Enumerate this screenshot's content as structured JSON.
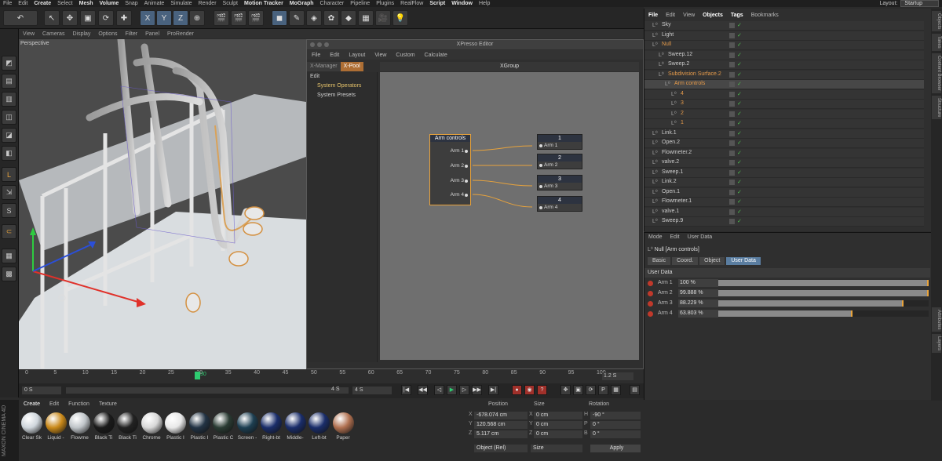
{
  "menubar": {
    "items": [
      "File",
      "Edit",
      "Create",
      "Select",
      "Mesh",
      "Volume",
      "Snap",
      "Animate",
      "Simulate",
      "Render",
      "Sculpt",
      "Motion Tracker",
      "MoGraph",
      "Character",
      "Pipeline",
      "Plugins",
      "RealFlow",
      "Script",
      "Window",
      "Help"
    ],
    "highlighted": [
      "Create",
      "Mesh",
      "Volume",
      "Motion Tracker",
      "MoGraph",
      "Script",
      "Window"
    ],
    "layout_label": "Layout:",
    "layout_value": "Startup"
  },
  "viewport": {
    "menu": [
      "View",
      "Cameras",
      "Display",
      "Options",
      "Filter",
      "Panel",
      "ProRender"
    ],
    "label": "Perspective"
  },
  "xpresso": {
    "title": "XPresso Editor",
    "menu": [
      "File",
      "Edit",
      "Layout",
      "View",
      "Custom",
      "Calculate"
    ],
    "tabs": [
      "X-Manager",
      "X-Pool"
    ],
    "active_tab": "X-Pool",
    "pool_edit": "Edit",
    "pool_items": [
      "System Operators",
      "System Presets"
    ],
    "group_title": "XGroup",
    "source_node": {
      "title": "Arm controls",
      "ports": [
        "Arm 1",
        "Arm 2",
        "Arm 3",
        "Arm 4"
      ]
    },
    "target_nodes": [
      {
        "title": "1",
        "port": "Arm 1"
      },
      {
        "title": "2",
        "port": "Arm 2"
      },
      {
        "title": "3",
        "port": "Arm 3"
      },
      {
        "title": "4",
        "port": "Arm 4"
      }
    ]
  },
  "object_manager": {
    "menu": [
      "File",
      "Edit",
      "View",
      "Objects",
      "Tags",
      "Bookmarks"
    ],
    "menu_bold": [
      "File",
      "Objects",
      "Tags"
    ],
    "rows": [
      {
        "name": "Sky",
        "indent": 0,
        "style": "normal"
      },
      {
        "name": "Light",
        "indent": 0,
        "style": "normal"
      },
      {
        "name": "Null",
        "indent": 0,
        "style": "orange"
      },
      {
        "name": "Sweep.12",
        "indent": 1,
        "style": "normal"
      },
      {
        "name": "Sweep.2",
        "indent": 1,
        "style": "normal"
      },
      {
        "name": "Subdivision Surface.2",
        "indent": 1,
        "style": "orange"
      },
      {
        "name": "Arm controls",
        "indent": 2,
        "style": "orange"
      },
      {
        "name": "4",
        "indent": 3,
        "style": "orange"
      },
      {
        "name": "3",
        "indent": 3,
        "style": "orange"
      },
      {
        "name": "2",
        "indent": 3,
        "style": "orange"
      },
      {
        "name": "1",
        "indent": 3,
        "style": "orange"
      },
      {
        "name": "Link.1",
        "indent": 0,
        "style": "normal"
      },
      {
        "name": "Open.2",
        "indent": 0,
        "style": "normal"
      },
      {
        "name": "Flowmeter.2",
        "indent": 0,
        "style": "normal"
      },
      {
        "name": "valve.2",
        "indent": 0,
        "style": "normal"
      },
      {
        "name": "Sweep.1",
        "indent": 0,
        "style": "normal"
      },
      {
        "name": "Link.2",
        "indent": 0,
        "style": "normal"
      },
      {
        "name": "Open.1",
        "indent": 0,
        "style": "normal"
      },
      {
        "name": "Flowmeter.1",
        "indent": 0,
        "style": "normal"
      },
      {
        "name": "valve.1",
        "indent": 0,
        "style": "normal"
      },
      {
        "name": "Sweep.9",
        "indent": 0,
        "style": "normal"
      }
    ]
  },
  "attributes": {
    "menu": [
      "Mode",
      "Edit",
      "User Data"
    ],
    "object_label": "Null [Arm controls]",
    "tabs": [
      "Basic",
      "Coord.",
      "Object",
      "User Data"
    ],
    "active_tab": "User Data",
    "section": "User Data",
    "params": [
      {
        "label": "Arm 1",
        "value": "100 %",
        "fraction": 1.0
      },
      {
        "label": "Arm 2",
        "value": "99.888 %",
        "fraction": 0.9989
      },
      {
        "label": "Arm 3",
        "value": "88.229 %",
        "fraction": 0.8823
      },
      {
        "label": "Arm 4",
        "value": "63.803 %",
        "fraction": 0.638
      }
    ]
  },
  "side_tabs": [
    "Objects",
    "Takes",
    "Content Browser",
    "Structure",
    "Attributes",
    "Layers"
  ],
  "timeline": {
    "ticks": [
      "0",
      "5",
      "10",
      "15",
      "20",
      "25",
      "30",
      "35",
      "40",
      "45",
      "50",
      "55",
      "60",
      "65",
      "70",
      "75",
      "80",
      "85",
      "90",
      "95",
      "100"
    ],
    "current_frame": "30",
    "fps_field": "1.2 S",
    "start": "0 S",
    "end_a": "4 S",
    "end_b": "4 S"
  },
  "materials": {
    "menu": [
      "Create",
      "Edit",
      "Function",
      "Texture"
    ],
    "items": [
      {
        "name": "Clear Sk",
        "color": "#cfd6dc"
      },
      {
        "name": "Liquid -",
        "color": "#c9891a"
      },
      {
        "name": "Flowme",
        "color": "#bfc4c8"
      },
      {
        "name": "Black Ti",
        "color": "#1a1a1a"
      },
      {
        "name": "Black Ti",
        "color": "#222222"
      },
      {
        "name": "Chrome",
        "color": "#d8d8d8"
      },
      {
        "name": "Plastic I",
        "color": "#e8e8e8"
      },
      {
        "name": "Plastic I",
        "color": "#223344"
      },
      {
        "name": "Plastic C",
        "color": "#2a3b33"
      },
      {
        "name": "Screen -",
        "color": "#1d3f52"
      },
      {
        "name": "Right-bt",
        "color": "#1a2d6a"
      },
      {
        "name": "Middle-",
        "color": "#1a2d6a"
      },
      {
        "name": "Left-bt",
        "color": "#1a2d6a"
      },
      {
        "name": "Paper",
        "color": "#b07050"
      }
    ]
  },
  "coordinates": {
    "headers": [
      "Position",
      "Size",
      "Rotation"
    ],
    "rows": [
      {
        "axis": "X",
        "pos": "-678.074 cm",
        "size_axis": "X",
        "size": "0 cm",
        "rot_axis": "H",
        "rot": "-90 °"
      },
      {
        "axis": "Y",
        "pos": "120.568 cm",
        "size_axis": "Y",
        "size": "0 cm",
        "rot_axis": "P",
        "rot": "0 °"
      },
      {
        "axis": "Z",
        "pos": "5.117 cm",
        "size_axis": "Z",
        "size": "0 cm",
        "rot_axis": "B",
        "rot": "0 °"
      }
    ],
    "mode": "Object (Rel)",
    "size_mode": "Size",
    "apply": "Apply"
  },
  "brand": "MAXON CINEMA 4D"
}
